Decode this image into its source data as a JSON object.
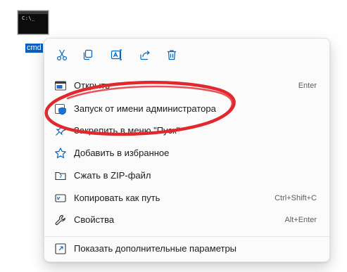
{
  "desktop": {
    "icon_name": "cmd",
    "icon_preview_text": "C:\\_"
  },
  "toolbar": {
    "buttons": [
      {
        "name": "cut",
        "icon": "scissors-icon"
      },
      {
        "name": "copy",
        "icon": "copy-icon"
      },
      {
        "name": "rename",
        "icon": "rename-icon"
      },
      {
        "name": "share",
        "icon": "share-icon"
      },
      {
        "name": "delete",
        "icon": "trash-icon"
      }
    ]
  },
  "menu": {
    "items": [
      {
        "label": "Открыть",
        "shortcut": "Enter",
        "icon": "cmd-window-icon"
      },
      {
        "label": "Запуск от имени администратора",
        "shortcut": "",
        "icon": "uac-shield-icon"
      },
      {
        "label": "Закрепить в меню \"Пуск\"",
        "shortcut": "",
        "icon": "pin-icon"
      },
      {
        "label": "Добавить в избранное",
        "shortcut": "",
        "icon": "star-icon"
      },
      {
        "label": "Сжать в ZIP-файл",
        "shortcut": "",
        "icon": "zip-folder-icon"
      },
      {
        "label": "Копировать как путь",
        "shortcut": "Ctrl+Shift+C",
        "icon": "copy-path-icon"
      },
      {
        "label": "Свойства",
        "shortcut": "Alt+Enter",
        "icon": "wrench-icon"
      },
      {
        "label": "Показать дополнительные параметры",
        "shortcut": "",
        "icon": "open-external-icon"
      }
    ]
  },
  "colors": {
    "accent": "#0067c0",
    "annotation": "#e0292f",
    "menu_bg": "#fbfbfb"
  }
}
